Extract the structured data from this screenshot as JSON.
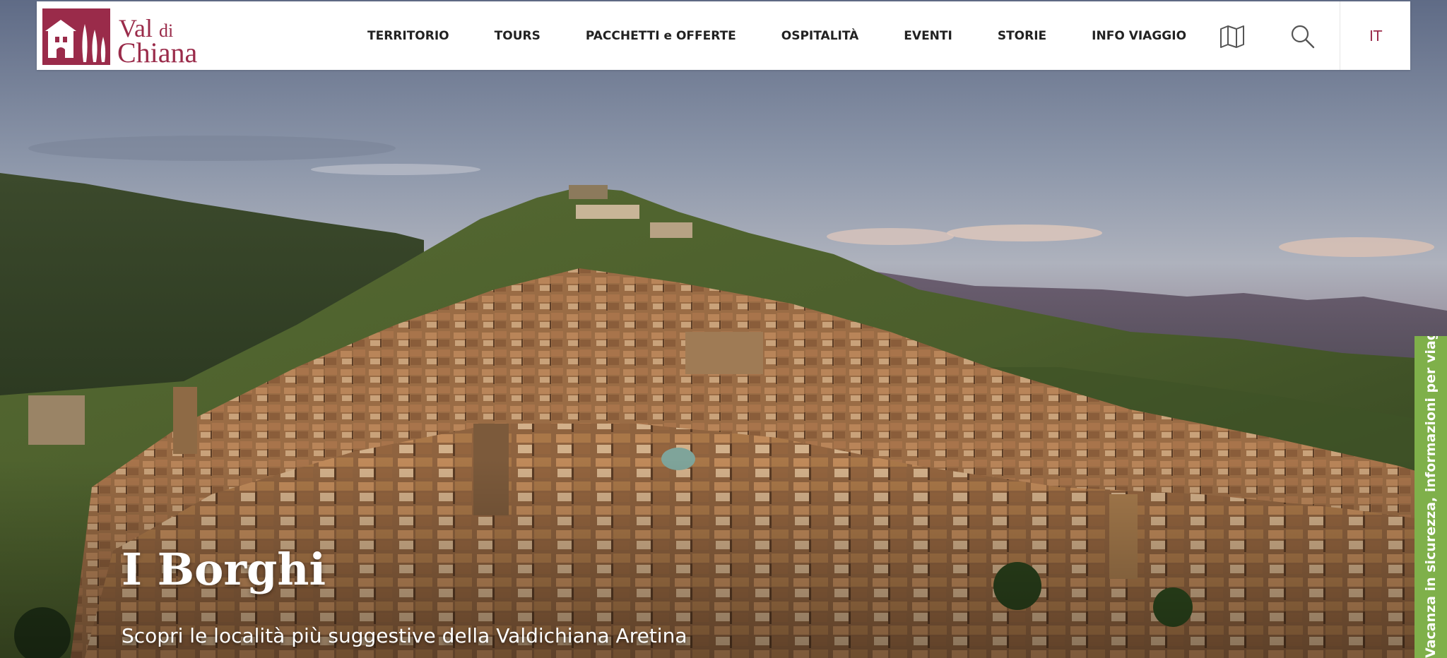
{
  "header": {
    "logo": {
      "line1_main": "Val",
      "line1_small": "di",
      "line2": "Chiana",
      "brand_color": "#9a2b4a"
    },
    "nav": [
      {
        "label": "TERRITORIO"
      },
      {
        "label": "TOURS"
      },
      {
        "label": "PACCHETTI e OFFERTE"
      },
      {
        "label": "OSPITALITÀ"
      },
      {
        "label": "EVENTI"
      },
      {
        "label": "STORIE"
      },
      {
        "label": "INFO VIAGGIO"
      }
    ],
    "icons": {
      "map": "map-icon",
      "search": "search-icon"
    },
    "language": "IT"
  },
  "hero": {
    "title": "I Borghi",
    "subtitle": "Scopri le località più suggestive della Valdichiana Aretina"
  },
  "side_tab": {
    "text": "Vacanza in sicurezza, informazioni per viaggiare",
    "color": "#7fb04a"
  }
}
